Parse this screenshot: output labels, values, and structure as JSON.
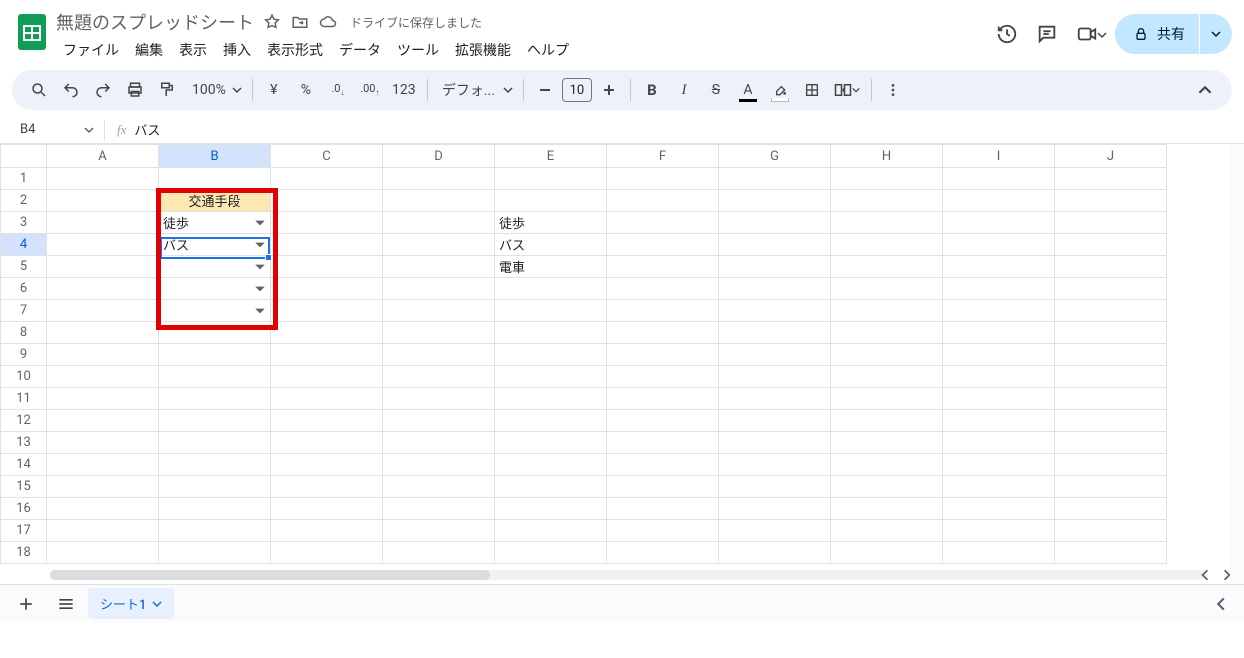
{
  "header": {
    "title": "無題のスプレッドシート",
    "save_status": "ドライブに保存しました"
  },
  "menus": {
    "file": "ファイル",
    "edit": "編集",
    "view": "表示",
    "insert": "挿入",
    "format": "表示形式",
    "data": "データ",
    "tools": "ツール",
    "extensions": "拡張機能",
    "help": "ヘルプ"
  },
  "share": {
    "label": "共有"
  },
  "toolbar": {
    "zoom": "100%",
    "currency": "¥",
    "percent": "%",
    "dec_dec": ".0",
    "inc_dec": ".00",
    "numfmt": "123",
    "font": "デフォ...",
    "fontsize": "10"
  },
  "fx": {
    "namebox": "B4",
    "formula": "バス"
  },
  "columns": [
    "A",
    "B",
    "C",
    "D",
    "E",
    "F",
    "G",
    "H",
    "I",
    "J"
  ],
  "rows": [
    "1",
    "2",
    "3",
    "4",
    "5",
    "6",
    "7",
    "8",
    "9",
    "10",
    "11",
    "12",
    "13",
    "14",
    "15",
    "16",
    "17",
    "18"
  ],
  "cells": {
    "b2": "交通手段",
    "b3": "徒歩",
    "b4": "バス",
    "e3": "徒歩",
    "e4": "バス",
    "e5": "電車"
  },
  "sheettabs": {
    "sheet1": "シート1"
  },
  "active_cell": "B4",
  "selected_col": "B",
  "selected_row": "4"
}
